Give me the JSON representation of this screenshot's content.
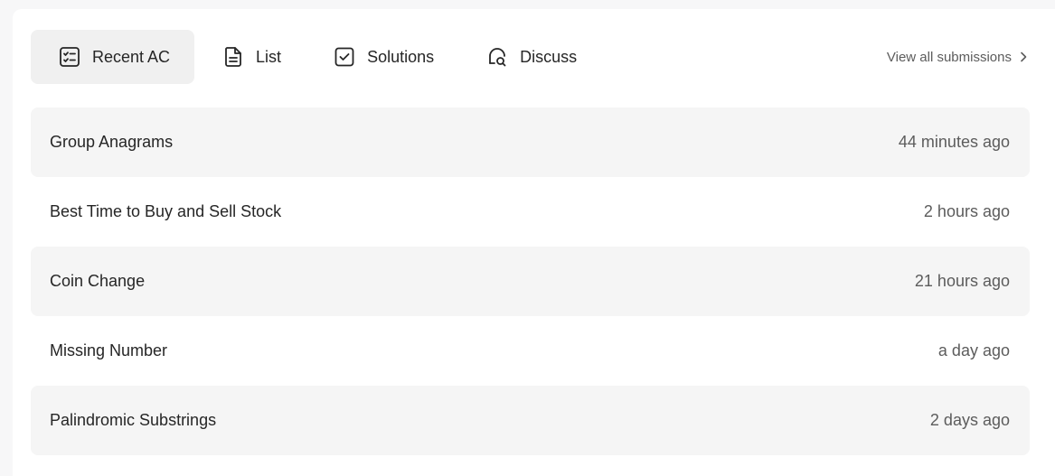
{
  "tabs": [
    {
      "label": "Recent AC",
      "icon": "checklist-icon",
      "active": true
    },
    {
      "label": "List",
      "icon": "document-icon",
      "active": false
    },
    {
      "label": "Solutions",
      "icon": "checkbox-icon",
      "active": false
    },
    {
      "label": "Discuss",
      "icon": "discussion-search-icon",
      "active": false
    }
  ],
  "view_all": {
    "label": "View all submissions",
    "icon": "chevron-right-icon"
  },
  "submissions": [
    {
      "title": "Group Anagrams",
      "time": "44 minutes ago"
    },
    {
      "title": "Best Time to Buy and Sell Stock",
      "time": "2 hours ago"
    },
    {
      "title": "Coin Change",
      "time": "21 hours ago"
    },
    {
      "title": "Missing Number",
      "time": "a day ago"
    },
    {
      "title": "Palindromic Substrings",
      "time": "2 days ago"
    }
  ],
  "colors": {
    "background": "#f7f7f8",
    "card": "#ffffff",
    "active_tab": "#f0f0f0",
    "row_shade": "#f5f5f5",
    "text_primary": "#262626",
    "text_secondary": "#5c5c5c"
  }
}
